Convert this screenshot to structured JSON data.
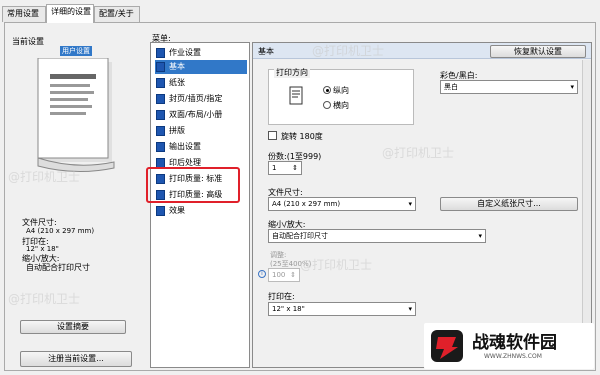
{
  "tabs": [
    "常用设置",
    "详细的设置",
    "配置/关于"
  ],
  "left": {
    "current_settings_label": "当前设置",
    "user_defined": "用户设置",
    "paper_size_label": "文件尺寸:",
    "paper_size_value": "A4 (210 x 297 mm)",
    "print_on_label": "打印在:",
    "print_on_value": "12\" x 18\"",
    "zoom_label": "缩小/放大:",
    "zoom_value": "自动配合打印尺寸",
    "summary_button": "设置摘要",
    "register_button": "注册当前设置..."
  },
  "menu": {
    "title": "菜单:",
    "items": [
      "作业设置",
      "基本",
      "纸张",
      "封页/插页/指定",
      "双面/布局/小册",
      "拼版",
      "输出设置",
      "印后处理",
      "打印质量: 标准",
      "打印质量: 高级",
      "效果"
    ],
    "selected_index": 1
  },
  "main": {
    "header": "基本",
    "restore_button": "恢复默认设置",
    "orientation_group": "打印方向",
    "portrait": "纵向",
    "landscape": "横向",
    "color_label": "彩色/黑白:",
    "color_value": "黑白",
    "rotate_label": "旋转 180度",
    "copies_label": "份数:(1至999)",
    "copies_value": "1",
    "paper_size_label": "文件尺寸:",
    "paper_size_value": "A4 (210 x 297 mm)",
    "custom_size_button": "自定义纸张尺寸...",
    "zoom_label": "缩小/放大:",
    "zoom_value": "自动配合打印尺寸",
    "zoom_adjust_label": "调整:",
    "zoom_range": "(25至400%)",
    "zoom_percent": "100",
    "print_on_label": "打印在:",
    "print_on_value": "12\" x 18\""
  },
  "watermarks": [
    "@打印机卫士",
    "@打印机卫士",
    "@打印机卫士",
    "@打印机卫士",
    "@打印机卫士"
  ],
  "logo": {
    "text": "战魂软件园",
    "url": "WWW.ZHNWS.COM"
  }
}
